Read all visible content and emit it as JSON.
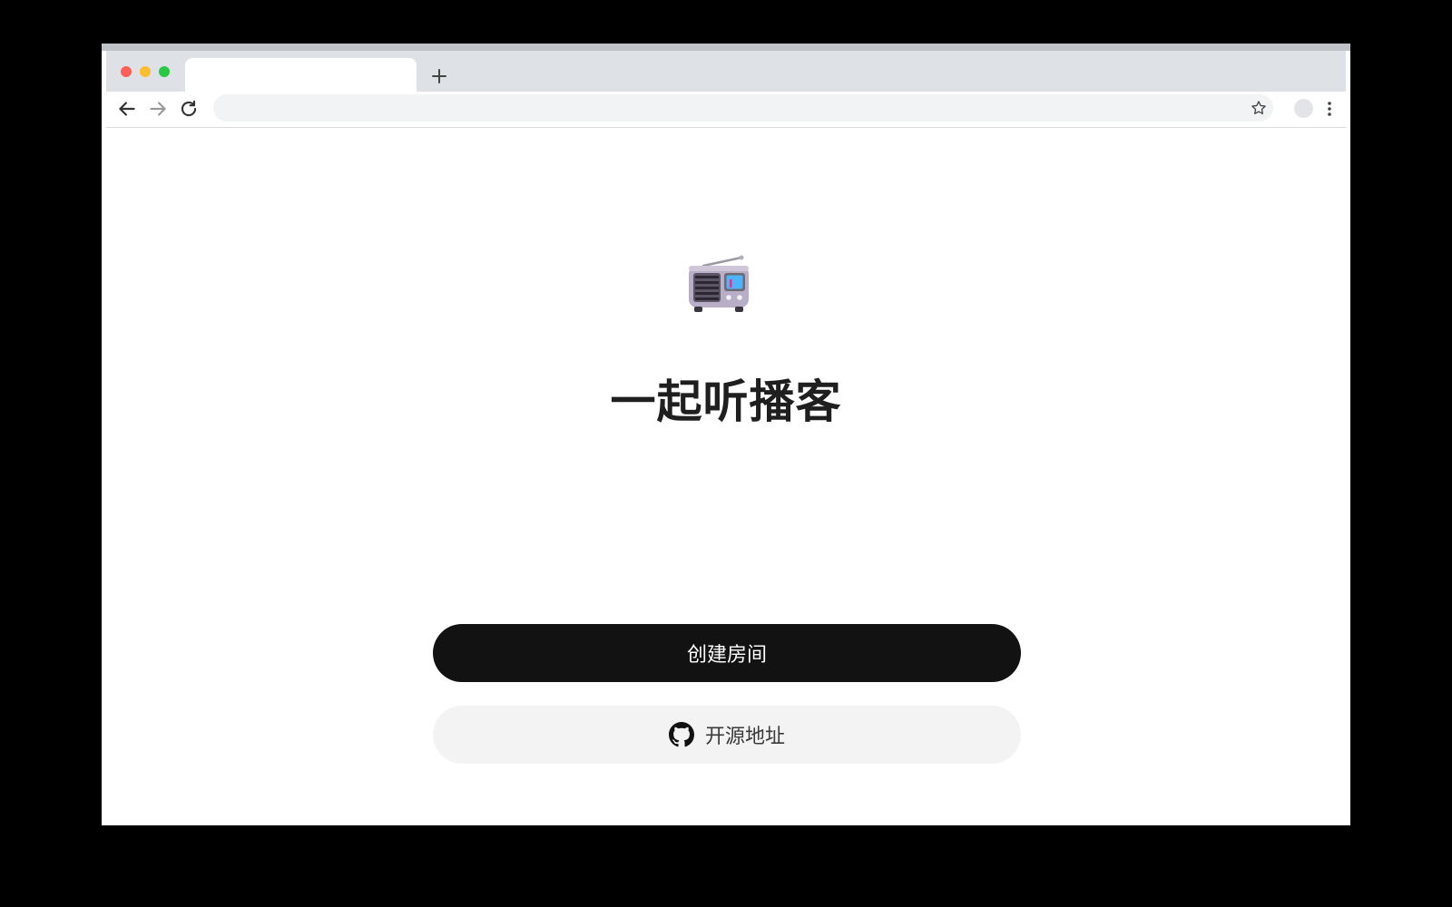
{
  "browser": {
    "tab_title": "",
    "new_tab_symbol": "+",
    "url": "",
    "icons": [
      "back-arrow-icon",
      "forward-arrow-icon",
      "reload-icon",
      "star-icon",
      "profile-avatar",
      "kebab-menu-icon"
    ],
    "traffic_light_colors": [
      "#fe5f57",
      "#febc2e",
      "#28c840"
    ]
  },
  "page": {
    "logo_icon": "radio-icon",
    "title": "一起听播客",
    "create_room_label": "创建房间",
    "source_label": "开源地址",
    "source_icon": "github-icon"
  },
  "colors": {
    "primary_button": "#121212",
    "secondary_button": "#f3f3f3",
    "title_text": "#1f1f1f"
  }
}
